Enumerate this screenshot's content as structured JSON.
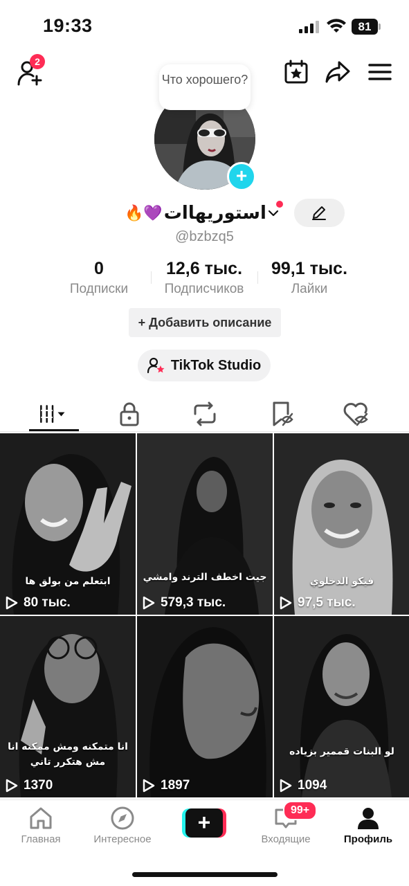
{
  "status_bar": {
    "time": "19:33",
    "battery": "81"
  },
  "header": {
    "friends_badge": "2",
    "bubble_text": "Что хорошего?"
  },
  "profile": {
    "display_name": "استوريهاات",
    "name_emoji": "🔥💜",
    "username": "@bzbzq5",
    "stats": [
      {
        "value": "0",
        "label": "Подписки"
      },
      {
        "value": "12,6 тыс.",
        "label": "Подписчиков"
      },
      {
        "value": "99,1 тыс.",
        "label": "Лайки"
      }
    ],
    "add_description_label": "+ Добавить описание",
    "studio_label": "TikTok Studio"
  },
  "tabs": [
    "videos-grid-icon",
    "lock-icon",
    "repost-icon",
    "favorites-icon",
    "liked-icon"
  ],
  "videos": [
    {
      "caption": "ابتعلم من بولق ها",
      "views": "80 тыс."
    },
    {
      "caption": "جيت اخطف الترند وامشي",
      "views": "579,3 тыс."
    },
    {
      "caption": "فيكو الدخلوي",
      "views": "97,5 тыс."
    },
    {
      "caption": "انا متمكنه ومش ممكنه انا مش هتكرر تاني",
      "views": "1370"
    },
    {
      "caption": "",
      "views": "1897"
    },
    {
      "caption": "لو البنات قممير بزياده",
      "views": "1094"
    }
  ],
  "bottom_nav": {
    "home": "Главная",
    "discover": "Интересное",
    "inbox": "Входящие",
    "inbox_badge": "99+",
    "profile": "Профиль"
  },
  "colors": {
    "accent": "#fe2c55",
    "teal": "#25f4ee",
    "avatar_add": "#20d5ec"
  }
}
